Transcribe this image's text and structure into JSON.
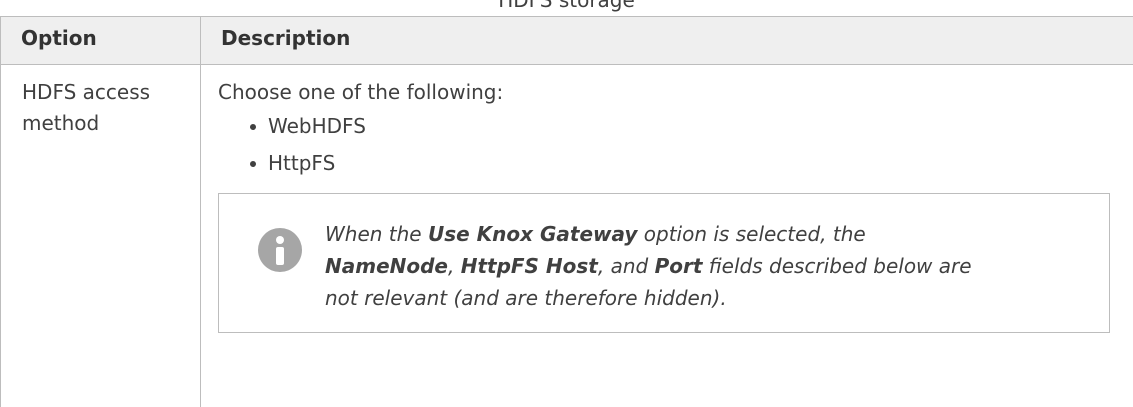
{
  "caption": "HDFS storage",
  "table": {
    "headers": [
      "Option",
      "Description"
    ],
    "row": {
      "option_line1": "HDFS access",
      "option_line2": "method",
      "intro": "Choose one of the following:",
      "choices": [
        "WebHDFS",
        "HttpFS"
      ],
      "note": {
        "icon": "info-icon",
        "t1": "When the ",
        "b1": "Use Knox Gateway",
        "t2": " option is selected, the",
        "b2": "NameNode",
        "t3": ", ",
        "b3": "HttpFS Host",
        "t4": ", and ",
        "b4": "Port",
        "t5": " fields described below are",
        "t6": "not relevant (and are therefore hidden)."
      }
    }
  }
}
